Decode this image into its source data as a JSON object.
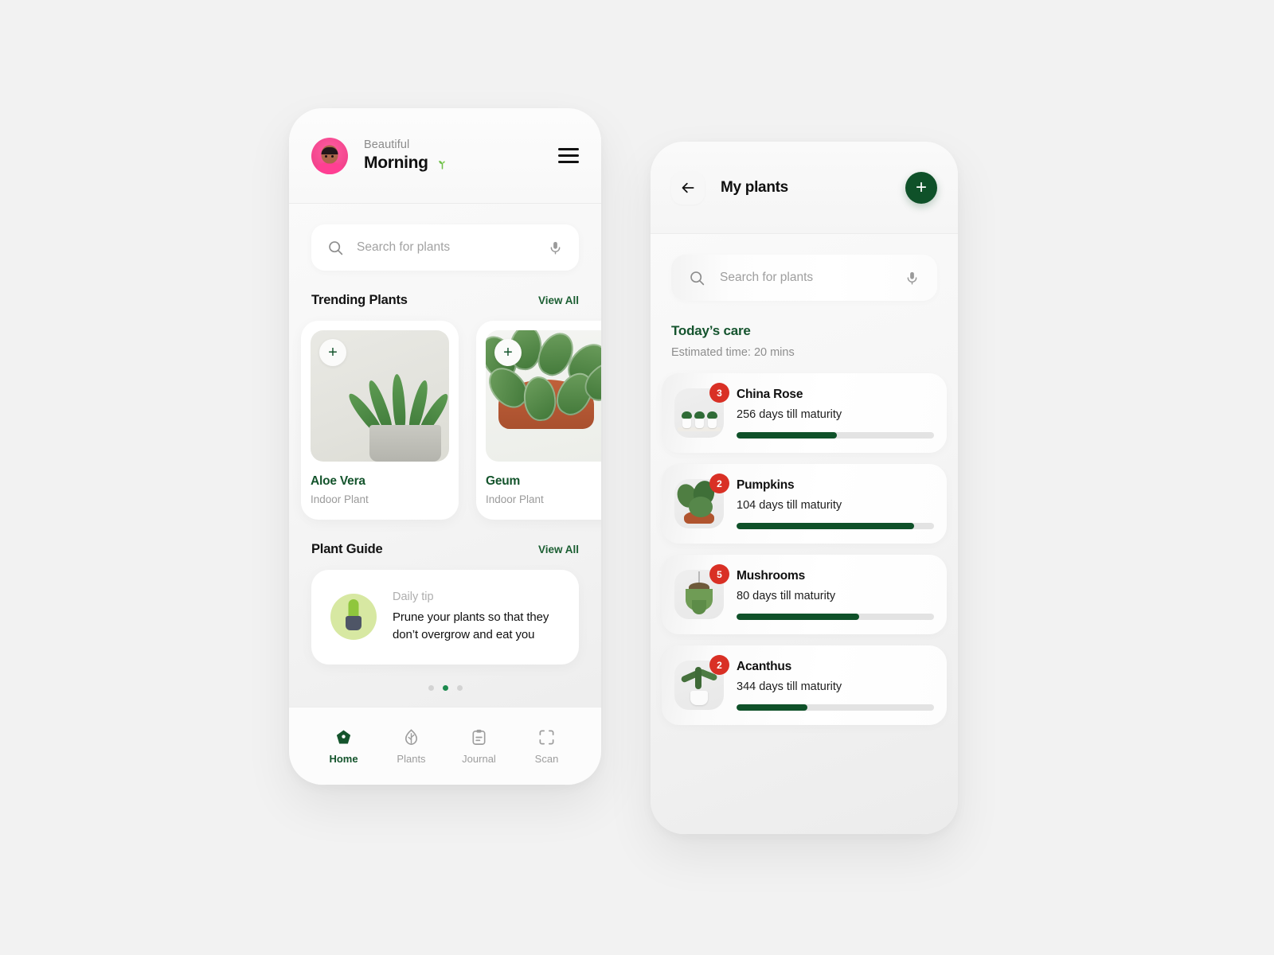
{
  "home": {
    "greeting_small": "Beautiful",
    "greeting_big": "Morning",
    "greeting_emoji": "🌱",
    "menu_icon": "hamburger-menu-icon",
    "avatar_alt": "user-avatar",
    "search": {
      "placeholder": "Search for plants",
      "value": "",
      "mic_icon": "microphone-icon",
      "search_icon": "search-icon"
    },
    "trending": {
      "title": "Trending Plants",
      "view_all": "View All",
      "cards": [
        {
          "name": "Aloe Vera",
          "type": "Indoor Plant",
          "add_label": "+"
        },
        {
          "name": "Geum",
          "type": "Indoor Plant",
          "add_label": "+"
        }
      ]
    },
    "guide": {
      "title": "Plant Guide",
      "view_all": "View All",
      "tip_label": "Daily tip",
      "tip_text": "Prune your plants so that they don’t overgrow and eat you",
      "dots": {
        "count": 3,
        "active_index": 1
      }
    },
    "tabs": [
      {
        "label": "Home",
        "icon": "home-icon",
        "active": true
      },
      {
        "label": "Plants",
        "icon": "leaf-icon",
        "active": false
      },
      {
        "label": "Journal",
        "icon": "clipboard-icon",
        "active": false
      },
      {
        "label": "Scan",
        "icon": "scan-frame-icon",
        "active": false
      }
    ]
  },
  "plants": {
    "back_icon": "arrow-left-icon",
    "title": "My plants",
    "add_label": "+",
    "search": {
      "placeholder": "Search for plants",
      "value": "",
      "mic_icon": "microphone-icon",
      "search_icon": "search-icon"
    },
    "care_title": "Today’s care",
    "care_subtitle": "Estimated time: 20 mins",
    "care_items": [
      {
        "name": "China Rose",
        "days": "256 days till maturity",
        "badge": "3",
        "progress": 51
      },
      {
        "name": "Pumpkins",
        "days": "104 days till maturity",
        "badge": "2",
        "progress": 90
      },
      {
        "name": "Mushrooms",
        "days": "80 days till maturity",
        "badge": "5",
        "progress": 62
      },
      {
        "name": "Acanthus",
        "days": "344 days till maturity",
        "badge": "2",
        "progress": 36
      }
    ]
  },
  "colors": {
    "brand_green": "#0f5129",
    "accent_green": "#1d8a4e",
    "badge_red": "#d93025",
    "page_bg": "#f2f2f2",
    "muted_text": "#9a9a9a"
  }
}
